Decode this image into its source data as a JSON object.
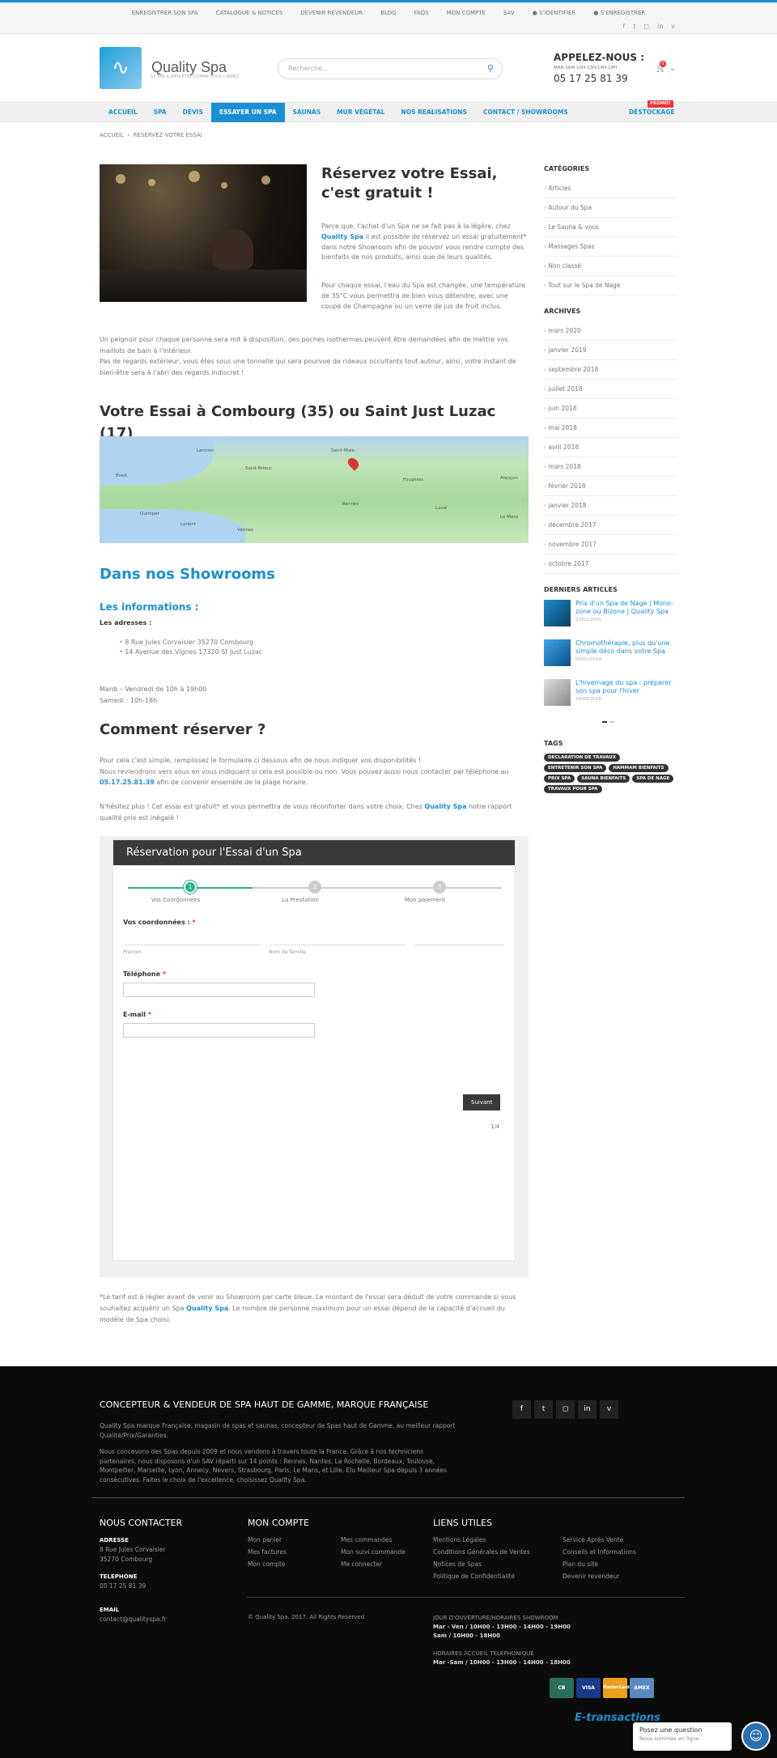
{
  "topnav": [
    "ENREGISTRER SON SPA",
    "CATALOGUE & NOTICES",
    "DEVENIR REVENDEUR",
    "BLOG",
    "FAQS",
    "MON COMPTE",
    "SAV",
    "S'IDENTIFIER",
    "S'ENREGISTRER"
  ],
  "brand": {
    "name": "Quality Spa",
    "tagline": "LE SPA & BIEN-ÊTRE COMME VOUS L'AIMEZ"
  },
  "search": {
    "placeholder": "Recherche..."
  },
  "call": {
    "title": "APPELEZ-NOUS :",
    "hours": "MAR-SAM 10H-13H/14H-18H",
    "phone": "05 17 25 81 39"
  },
  "cart": {
    "count": "0"
  },
  "mainnav": [
    "ACCUEIL",
    "SPA",
    "DEVIS",
    "ESSAYER UN SPA",
    "SAUNAS",
    "MUR VÉGÉTAL",
    "NOS REALISATIONS",
    "CONTACT / SHOWROOMS"
  ],
  "destock": {
    "label": "DESTOCKAGE",
    "badge": "PROMO!"
  },
  "breadcrumb": {
    "home": "ACCUEIL",
    "sep": "›",
    "current": "RÉSERVEZ VOTRE ESSAI"
  },
  "page": {
    "title": "Réservez votre Essai, c'est gratuit !",
    "p1a": "Parce que, l'achat d'un Spa ne se fait pas à la légère, chez ",
    "p1b": "Quality Spa",
    "p1c": " il est possible de réservez un essai gratuitement* dans notre Showroom afin de pouvoir vous rendre compte des bienfaits de nos produits, ainsi que de leurs qualités.",
    "p2": "Pour chaque essai, l'eau du Spa est changée, une température de 35°C vous permettra de bien vous détendre, avec une coupe de Champagne ou un verre de jus de fruit inclus.",
    "p3a": "Un peignoir pour chaque personne sera mit à disposition, des poches isothermes peuvent être demandées afin de mettre vos maillots de bain à l'intérieur.",
    "p3b": "Pas de regards extérieur, vous êtes sous une tonnelle qui sera pourvue de rideaux occultants tout autour, ainsi, votre instant de bien-être sera à l'abri des regards indiscret !",
    "map_title": "Votre Essai à Combourg (35) ou Saint Just Luzac (17)",
    "map_labels": [
      "Brest",
      "Quimper",
      "Lorient",
      "Vannes",
      "Rennes",
      "Saint-Malo",
      "Fougères",
      "Laval",
      "Le Mans",
      "Alençon",
      "Saint-Brieuc",
      "Lannion"
    ],
    "showroom_pre": "Dans nos ",
    "showroom_b": "Showrooms",
    "info_pre": "Les ",
    "info_b": "informations :",
    "addr_label": "Les adresses :",
    "addresses": [
      "8 Rue Jules Corvaisier 35270 Combourg",
      "14 Avenue des Vignes 17320 St Just Luzac"
    ],
    "hours1": "Mardi – Vendredi de 10h à 19h00",
    "hours2": "Samedi : 10h-18h",
    "reserve_title": "Comment réserver ?",
    "p4a": "Pour cela c'est simple, remplissez le formulaire ci dessous afin de nous indiquer vos disponibilités !",
    "p4b": "Nous reviendrons vers vous en vous indiquant si cela est possible ou non. Vous pouvez aussi nous contacter par téléphone au ",
    "p4phone": "05.17.25.81.39",
    "p4c": " afin de convenir ensemble de la plage horaire.",
    "p5a": "N'hésitez plus ! Cet essai est gratuit* et vous permettra de vous réconforter dans votre choix. Chez ",
    "p5b": "Quality Spa",
    "p5c": " notre rapport qualité prix est inégalé !",
    "p6a": "*Le tarif est à régler avant de venir au Showroom par carte bleue. Le montant de l'essai sera déduit de votre commande si vous souhaitez acquérir un Spa ",
    "p6b": "Quality Spa",
    "p6c": ". Le nombre de personne maximum pour un essai dépend de la capacité d'accueil du modèle de Spa choisi."
  },
  "form": {
    "title": "Réservation pour l'Essai d'un Spa",
    "steps": [
      {
        "num": "1",
        "label": "Vos Coordonnées"
      },
      {
        "num": "2",
        "label": "La Prestation"
      },
      {
        "num": "3",
        "label": "Mon paiement"
      }
    ],
    "coord_label": "Vos coordonnées :",
    "star": "*",
    "first": "Prénom",
    "last": "Nom de famille",
    "phone_label": "Téléphone",
    "email_label": "E-mail",
    "next": "Suivant",
    "page": "1/4"
  },
  "sidebar": {
    "cat_title": "CATÉGORIES",
    "categories": [
      "Articles",
      "Autour du Spa",
      "Le Sauna & vous",
      "Massages Spas",
      "Non classé",
      "Tout sur le Spa de Nage"
    ],
    "arch_title": "ARCHIVES",
    "archives": [
      "mars 2020",
      "janvier 2019",
      "septembre 2018",
      "juillet 2018",
      "juin 2018",
      "mai 2018",
      "avril 2018",
      "mars 2018",
      "février 2018",
      "janvier 2018",
      "décembre 2017",
      "novembre 2017",
      "octobre 2017"
    ],
    "recent_title": "DERNIERS ARTICLES",
    "recent": [
      {
        "title": "Prix d'un Spa de Nage | Mono-zone ou Bizone | Quality Spa",
        "date": "23/03/2020"
      },
      {
        "title": "Chromothérapie, plus qu'une simple déco dans votre Spa",
        "date": "09/01/2019"
      },
      {
        "title": "L'hivernage du spa : préparer son spa pour l'hiver",
        "date": "29/09/2018"
      }
    ],
    "tags_title": "TAGS",
    "tags": [
      "DECLARATION DE TRAVAUX",
      "ENTRETENIR SON SPA",
      "HAMMAM BIENFAITS",
      "PRIX SPA",
      "SAUNA BIENFAITS",
      "SPA DE NAGE",
      "TRAVAUX POUR SPA"
    ]
  },
  "footer": {
    "title": "CONCEPTEUR & VENDEUR DE SPA HAUT DE GAMME, MARQUE FRANÇAISE",
    "p1": "Quality Spa marque Française, magasin de spas et saunas, concepteur de Spas haut de Gamme, au meilleur rapport Qualité/Prix/Garanties.",
    "p2": "Nous concevons des Spas depuis 2009 et nous vendons à travers toute la France. Grâce à nos techniciens partenaires, nous disposons d'un SAV réparti sur 14 points : Rennes, Nantes, La Rochelle, Bordeaux, Toulouse, Montpellier, Marseille, Lyon, Annecy, Nevers, Strasbourg, Paris, Le Mans, et Lille. Elu Meilleur Spa depuis 3 années consécutives. Faites le choix de l'excellence, choisissez Quality Spa.",
    "contact_title": "NOUS CONTACTER",
    "adresse_l": "ADRESSE",
    "adresse1": "8 Rue Jules Corvaisier",
    "adresse2": "35270 Combourg",
    "tel_l": "TELEPHONE",
    "tel": "05 17 25 81 39",
    "email_l": "EMAIL",
    "email": "contact@qualityspa.fr",
    "compte_title": "MON COMPTE",
    "compte1": [
      "Mon panier",
      "Mes factures",
      "Mon compte"
    ],
    "compte2": [
      "Mes commandes",
      "Mon suivi commande",
      "Me connecter"
    ],
    "liens_title": "LIENS UTILES",
    "liens1": [
      "Mentions Légales",
      "Conditions Générales de Ventes",
      "Notices de Spas",
      "Politique de Confidentialité"
    ],
    "liens2": [
      "Service Après Vente",
      "Conseils et Informations",
      "Plan du site",
      "Devenir revendeur"
    ],
    "copy": "© Quality Spa. 2017. All Rights Reserved",
    "show_t": "JOUR D'OUVERTURE/HORAIRES SHOWROOM",
    "show1": "Mar - Ven / 10H00 - 13H00 - 14H00 - 19H00",
    "show2": "Sam / 10H00 - 18H00",
    "tel_t": "HORAIRES ACCUEIL TELEPHONIQUE",
    "tel1": "Mar -Sam / 10H00 - 13H00 - 14H00 - 18H00",
    "cards": [
      "CB",
      "VISA",
      "MasterCard",
      "AMEX"
    ],
    "etrans": "E-transactions"
  },
  "chat": {
    "title": "Posez une question",
    "status": "Nous sommes en ligne"
  }
}
